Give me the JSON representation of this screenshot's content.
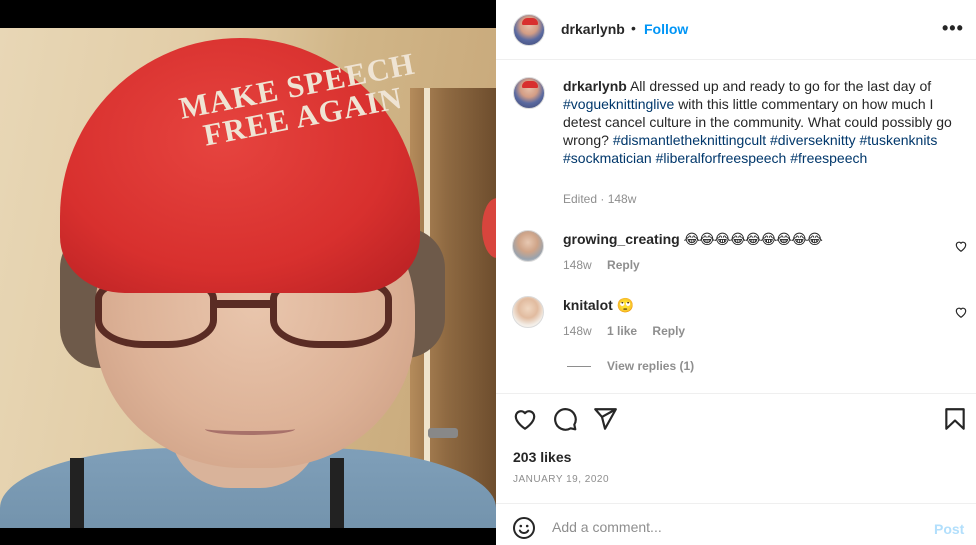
{
  "post": {
    "username": "drkarlynb",
    "follow_label": "Follow",
    "more_icon": "more-options-icon",
    "caption_username": "drkarlynb",
    "caption_text_1": "All dressed up and ready to go for the last day of",
    "hashtag_vogue": "#vogueknittinglive",
    "caption_text_2": "with this little commentary on how much I detest cancel culture in the community. What could possibly go wrong?",
    "hashtags": [
      "#dismantletheknittingcult",
      "#diverseknitty",
      "#tuskenknits",
      "#sockmatician",
      "#liberalforfreespeech",
      "#freespeech"
    ],
    "edited_meta": "Edited · 148w"
  },
  "photo": {
    "cap_line_1": "MAKE SPEECH",
    "cap_line_2": "FREE AGAIN",
    "cap_color": "#d8302e"
  },
  "comments": [
    {
      "username": "growing_creating",
      "text": "😂😂😂😂😂😂😂😂😂",
      "age": "148w",
      "likes": "",
      "reply_label": "Reply"
    },
    {
      "username": "knitalot",
      "text": "🙄",
      "age": "148w",
      "likes": "1 like",
      "reply_label": "Reply"
    }
  ],
  "view_replies_label": "View replies (1)",
  "likes_count": "203 likes",
  "post_date": "JANUARY 19, 2020",
  "add_comment": {
    "placeholder": "Add a comment...",
    "post_label": "Post"
  },
  "colors": {
    "link": "#0095f6",
    "hashtag": "#00376b",
    "muted": "#8e8e8e",
    "post_disabled": "#b2dffc"
  }
}
